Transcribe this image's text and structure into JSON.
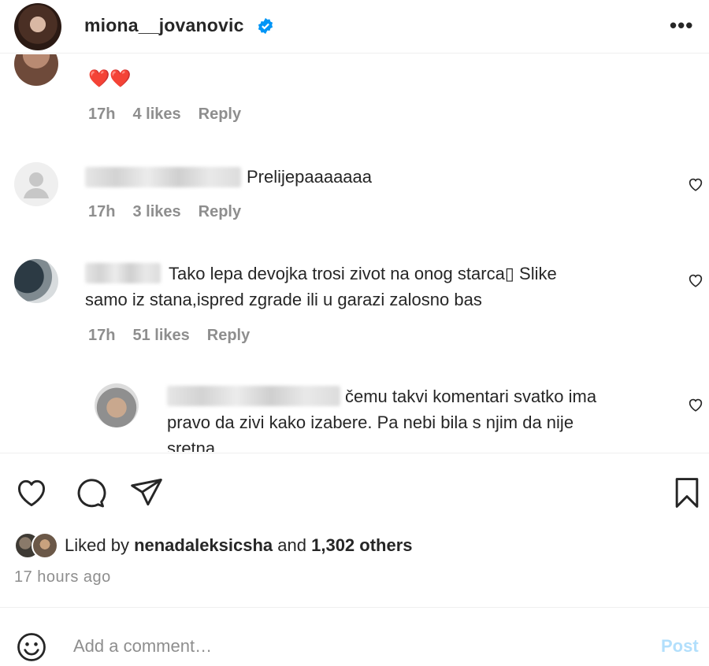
{
  "header": {
    "username": "miona__jovanovic",
    "more_label": "•••"
  },
  "comments": [
    {
      "text": "",
      "emoji": "❤️❤️",
      "time": "17h",
      "likes": "4 likes",
      "reply": "Reply"
    },
    {
      "text": "Prelijepaaaaaaa",
      "time": "17h",
      "likes": "3 likes",
      "reply": "Reply"
    },
    {
      "text_line1": "Tako lepa devojka trosi zivot na onog starca▯ Slike",
      "text_line2": "samo iz stana,ispred zgrade ili u garazi zalosno bas",
      "time": "17h",
      "likes": "51 likes",
      "reply": "Reply"
    },
    {
      "text_line1": "čemu takvi komentari svatko ima",
      "text_line2": "pravo da zivi kako izabere. Pa nebi bila s njim da nije",
      "text_line3": "sretna"
    }
  ],
  "likes": {
    "prefix": "Liked by ",
    "user": "nenadaleksicsha",
    "middle": " and ",
    "count": "1,302 others"
  },
  "posted": "17 hours ago",
  "add_comment": {
    "placeholder": "Add a comment…",
    "post_label": "Post"
  },
  "colors": {
    "verified": "#0095f6",
    "heart": "#ed4956",
    "post_disabled": "#b2dffc"
  }
}
